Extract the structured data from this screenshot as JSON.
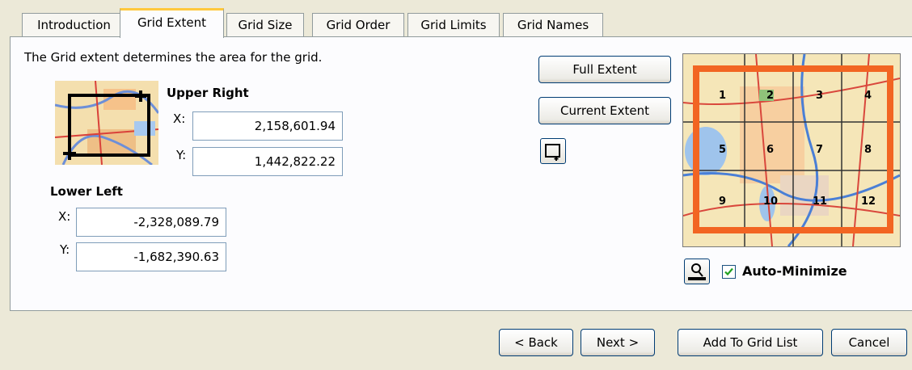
{
  "tabs": [
    {
      "label": "Introduction"
    },
    {
      "label": "Grid Extent"
    },
    {
      "label": "Grid Size"
    },
    {
      "label": "Grid Order"
    },
    {
      "label": "Grid Limits"
    },
    {
      "label": "Grid Names"
    }
  ],
  "active_tab": "Grid Extent",
  "description": "The Grid extent determines the area for the grid.",
  "upper_right": {
    "label": "Upper Right",
    "x_label": "X:",
    "y_label": "Y:",
    "x": "2,158,601.94",
    "y": "1,442,822.22"
  },
  "lower_left": {
    "label": "Lower Left",
    "x_label": "X:",
    "y_label": "Y:",
    "x": "-2,328,089.79",
    "y": "-1,682,390.63"
  },
  "buttons": {
    "full_extent": "Full Extent",
    "current_extent": "Current Extent"
  },
  "preview": {
    "cell_numbers": [
      "1",
      "2",
      "3",
      "4",
      "5",
      "6",
      "7",
      "8",
      "9",
      "10",
      "11",
      "12"
    ],
    "frame_color": "#f26522"
  },
  "auto_minimize": {
    "label": "Auto-Minimize",
    "checked": true
  },
  "footer": {
    "back": "< Back",
    "next": "Next >",
    "add": "Add To Grid List",
    "cancel": "Cancel"
  },
  "icons": [
    "extent-thumbnail-icon",
    "draw-extent-icon",
    "zoom-preview-icon",
    "checkmark-icon"
  ]
}
